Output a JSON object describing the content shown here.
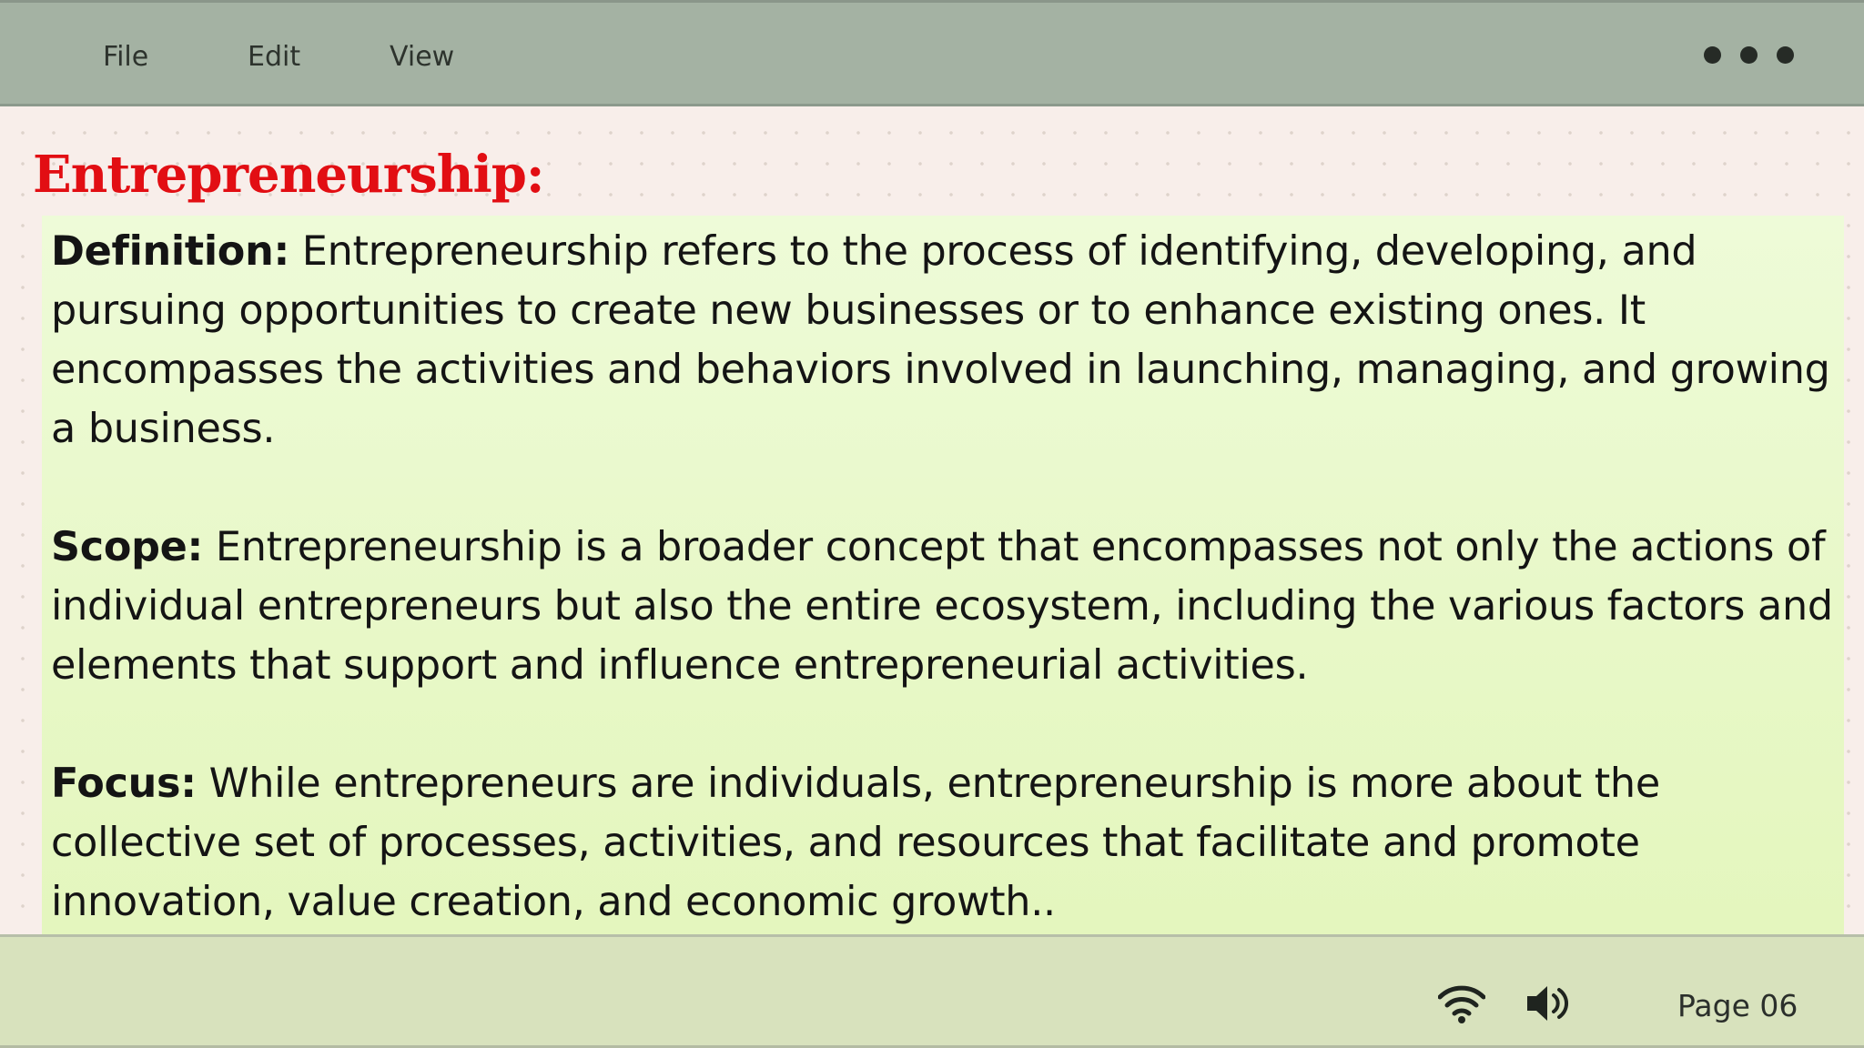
{
  "menu": {
    "items": [
      "File",
      "Edit",
      "View"
    ],
    "more_icon": "more-dots-icon"
  },
  "content": {
    "heading": "Entrepreneurship:",
    "paragraphs": [
      {
        "label": "Definition:",
        "text": " Entrepreneurship refers to the process of identifying, developing, and pursuing opportunities to create new businesses or to enhance existing ones. It encompasses the activities and behaviors involved in launching, managing, and growing a business."
      },
      {
        "label": "Scope:",
        "text": " Entrepreneurship is a broader concept that encompasses not only the actions of individual entrepreneurs but also the entire ecosystem, including the various factors and elements that support and influence entrepreneurial activities."
      },
      {
        "label": "Focus:",
        "text": " While entrepreneurs are individuals, entrepreneurship is more about the collective set of processes, activities, and resources that facilitate and promote innovation, value creation, and economic growth.."
      }
    ]
  },
  "statusbar": {
    "wifi_icon": "wifi-icon",
    "volume_icon": "speaker-volume-icon",
    "page_label": "Page 06"
  },
  "colors": {
    "heading": "#e20e13",
    "topbar": "#a4b2a3",
    "bottombar": "#d8e2bd",
    "text_panel": "#e8f8c8"
  }
}
